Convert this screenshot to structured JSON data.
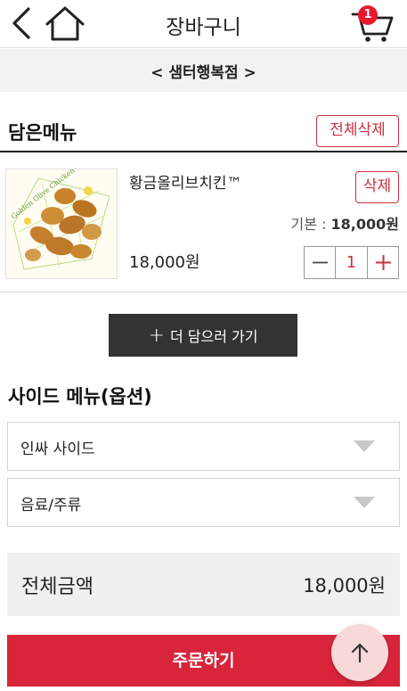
{
  "header": {
    "title": "장바구니",
    "cart_count": "1",
    "back_icon": "chevron-left-icon",
    "home_icon": "home-icon",
    "cart_icon": "cart-icon"
  },
  "store": {
    "name": "< 샘터행복점 >"
  },
  "cart_section": {
    "title": "담은메뉴",
    "delete_all_label": "전체삭제"
  },
  "items": [
    {
      "name": "황금올리브치킨™",
      "delete_label": "삭제",
      "base_price_label": "기본 : ",
      "base_price": "18,000원",
      "price": "18,000원",
      "quantity": "1",
      "image_label": "Golden Olive Chicken"
    }
  ],
  "more_button": {
    "plus": "+",
    "label": "더 담으러 가기"
  },
  "side_menu": {
    "title": "사이드 메뉴(옵션)",
    "dropdowns": [
      {
        "label": "인싸 사이드"
      },
      {
        "label": "음료/주류"
      }
    ]
  },
  "total": {
    "label": "전체금액",
    "value": "18,000원"
  },
  "order_button": {
    "label": "주문하기"
  },
  "colors": {
    "accent": "#d8253a",
    "brand_red": "#c8313f",
    "badge": "#e8192c"
  }
}
